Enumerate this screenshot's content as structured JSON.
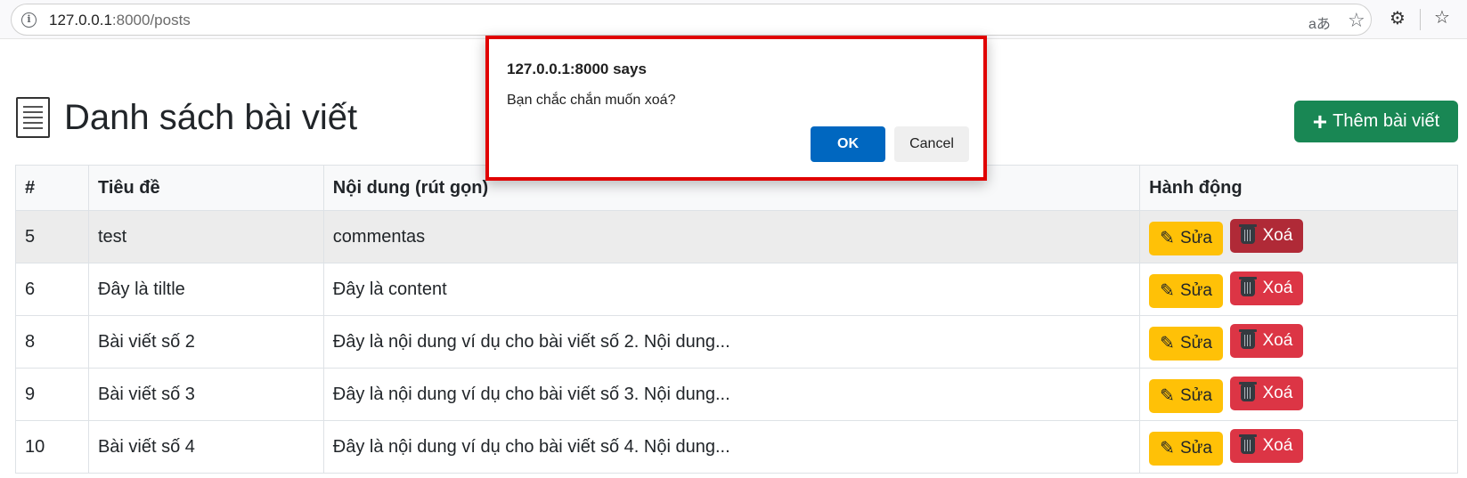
{
  "browser": {
    "url_host": "127.0.0.1",
    "url_path": ":8000/posts",
    "translate_glyph": "aあ",
    "icons": [
      "info-icon",
      "translate-icon",
      "star-icon",
      "extensions-icon",
      "favorites-icon"
    ]
  },
  "page": {
    "title": "Danh sách bài viết",
    "add_button_label": "Thêm bài viết",
    "colors": {
      "add_button": "#198754",
      "edit_button": "#ffc107",
      "delete_button": "#dc3545"
    }
  },
  "table": {
    "headers": [
      "#",
      "Tiêu đề",
      "Nội dung (rút gọn)",
      "Hành động"
    ],
    "rows": [
      {
        "id": "5",
        "title": "test",
        "content": "commentas"
      },
      {
        "id": "6",
        "title": "Đây là tiltle",
        "content": "Đây là content"
      },
      {
        "id": "8",
        "title": "Bài viết số 2",
        "content": "Đây là nội dung ví dụ cho bài viết số 2. Nội dung..."
      },
      {
        "id": "9",
        "title": "Bài viết số 3",
        "content": "Đây là nội dung ví dụ cho bài viết số 3. Nội dung..."
      },
      {
        "id": "10",
        "title": "Bài viết số 4",
        "content": "Đây là nội dung ví dụ cho bài viết số 4. Nội dung..."
      }
    ],
    "edit_label": "Sửa",
    "delete_label": "Xoá"
  },
  "dialog": {
    "title": "127.0.0.1:8000 says",
    "message": "Bạn chắc chắn muốn xoá?",
    "ok_label": "OK",
    "cancel_label": "Cancel"
  }
}
